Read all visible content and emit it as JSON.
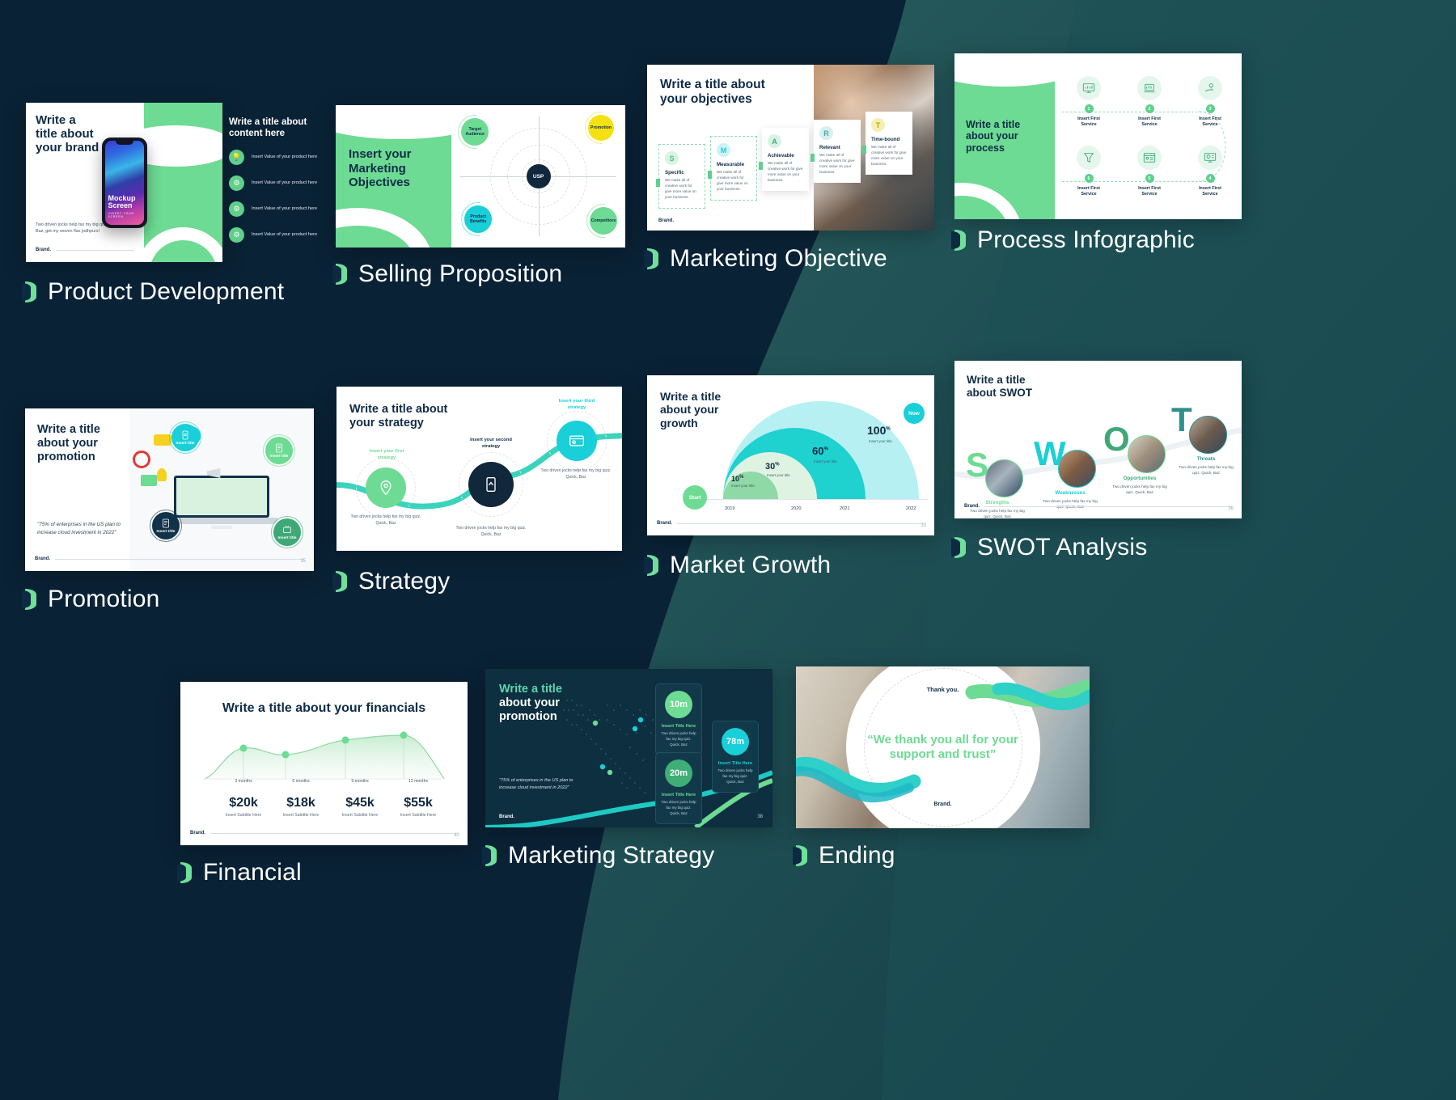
{
  "theme": {
    "bg_navy": "#0a2236",
    "bg_teal": "#1c4f50",
    "green": "#6ddb93",
    "cyan": "#19cfd8",
    "yellow": "#f5e111",
    "navy_text": "#0f2c47"
  },
  "slides": [
    {
      "id": "product",
      "caption": "Product Development",
      "title": "Write a title title about your brand",
      "title_lines": [
        "Write a",
        "title about",
        "your brand"
      ],
      "body": "Two driven jocks help fax my big quiz. Quick, Baz, get my woven flax jodhpurs!",
      "brand": "Brand.",
      "mockup_title_lines": [
        "Mockup",
        "Screen"
      ],
      "mockup_sub": "INSERT YOUR SCREEN",
      "side_title_lines": [
        "Write a title about",
        "content here"
      ],
      "side_items": [
        {
          "icon": "lightbulb-icon",
          "text": "Insert Value of your product here"
        },
        {
          "icon": "gear-icon",
          "text": "Insert Value of your product here"
        },
        {
          "icon": "gear-icon",
          "text": "Insert Value of your product here"
        },
        {
          "icon": "gear-icon",
          "text": "Insert Value of your product here"
        }
      ]
    },
    {
      "id": "selling",
      "caption": "Selling Proposition",
      "title_lines": [
        "Insert your",
        "Marketing",
        "Objectives"
      ],
      "center_label": "USP",
      "bubbles": [
        {
          "label": "Target Audience",
          "color": "#6ddb93"
        },
        {
          "label": "Promotion",
          "color": "#f5e111"
        },
        {
          "label": "Product Benefits",
          "color": "#19cfd8"
        },
        {
          "label": "Competitors",
          "color": "#6ddb93"
        }
      ]
    },
    {
      "id": "objective",
      "caption": "Marketing Objective",
      "title_lines": [
        "Write a title about",
        "your objectives"
      ],
      "brand": "Brand.",
      "cards": [
        {
          "letter": "S",
          "title": "Specific",
          "desc": "We make all of creative work for give more value on your business.",
          "badge_bg": "#d9f3e3",
          "badge_fg": "#4cc484"
        },
        {
          "letter": "M",
          "title": "Measurable",
          "desc": "We make all of creative work for give more value on your business.",
          "badge_bg": "#cdf3f6",
          "badge_fg": "#19cfd8"
        },
        {
          "letter": "A",
          "title": "Achievable",
          "desc": "We make all of creative work for give more value on your business.",
          "badge_bg": "#d9f3e3",
          "badge_fg": "#3fa877"
        },
        {
          "letter": "R",
          "title": "Relevant",
          "desc": "We make all of creative work for give more value on your business.",
          "badge_bg": "#d8eef0",
          "badge_fg": "#4aa9a8"
        },
        {
          "letter": "T",
          "title": "Time-bound",
          "desc": "We make all of creative work for give more value on your business.",
          "badge_bg": "#f6efb4",
          "badge_fg": "#b8a400"
        }
      ]
    },
    {
      "id": "process",
      "caption": "Process Infographic",
      "title_lines": [
        "Write a title",
        "about your",
        "process"
      ],
      "steps": [
        {
          "num": "1",
          "label_lines": [
            "Insert First",
            "Service"
          ],
          "icon": "monitor-chart-icon"
        },
        {
          "num": "2",
          "label_lines": [
            "Insert First",
            "Service"
          ],
          "icon": "laptop-chart-icon"
        },
        {
          "num": "3",
          "label_lines": [
            "Insert First",
            "Service"
          ],
          "icon": "hand-idea-icon"
        },
        {
          "num": "4",
          "label_lines": [
            "Insert First",
            "Service"
          ],
          "icon": "monitor-pie-icon"
        },
        {
          "num": "5",
          "label_lines": [
            "Insert First",
            "Service"
          ],
          "icon": "browser-user-icon"
        },
        {
          "num": "6",
          "label_lines": [
            "Insert First",
            "Service"
          ],
          "icon": "funnel-icon"
        }
      ]
    },
    {
      "id": "promotion",
      "caption": "Promotion",
      "title_lines": [
        "Write a title",
        "about your",
        "promotion"
      ],
      "quote": "\"75% of enterprises in the US plan to increase cloud investment in 2022\"",
      "brand": "Brand.",
      "page": "35",
      "bubbles": [
        {
          "label": "Insert title",
          "color": "#19cfd8",
          "icon": "mobile-settings-icon"
        },
        {
          "label": "Insert title",
          "color": "#6ddb93",
          "icon": "document-gear-icon"
        },
        {
          "label": "Insert title",
          "color": "#11324a",
          "icon": "document-user-icon"
        },
        {
          "label": "Insert title",
          "color": "#3fa877",
          "icon": "tv-icon"
        }
      ]
    },
    {
      "id": "strategy",
      "caption": "Strategy",
      "title_lines": [
        "Write a title about",
        "your strategy"
      ],
      "nodes": [
        {
          "label_lines": [
            "Insert your first",
            "strategy"
          ],
          "desc": "Two driven jocks help fax my big quiz. Quick, Baz",
          "color": "#6ddb93",
          "label_color": "#6ddb93",
          "icon": "location-pin-icon"
        },
        {
          "label_lines": [
            "Insert your second",
            "strategy"
          ],
          "desc": "Two driven jocks help fax my big quiz. Quick, Baz",
          "color": "#11273c",
          "label_color": "#0f2c47",
          "icon": "mobile-map-icon"
        },
        {
          "label_lines": [
            "Insert your third",
            "strategy"
          ],
          "desc": "Two driven jocks help fax my big quiz. Quick, Baz",
          "color": "#19cfd8",
          "label_color": "#19cfd8",
          "icon": "browser-ad-icon"
        }
      ]
    },
    {
      "id": "growth",
      "caption": "Market Growth",
      "title_lines": [
        "Write a title",
        "about your",
        "growth"
      ],
      "start_label": "Start",
      "now_label": "Now",
      "brand": "Brand.",
      "page": "33",
      "arcs": [
        {
          "value": "10",
          "unit": "%",
          "sub": "Insert your title",
          "year": "2019",
          "color": "#8ed9a5"
        },
        {
          "value": "30",
          "unit": "%",
          "sub": "Insert your title",
          "year": "2020",
          "color": "#dff3e3"
        },
        {
          "value": "60",
          "unit": "%",
          "sub": "Insert your title",
          "year": "2021",
          "color": "#1fd1cf"
        },
        {
          "value": "100",
          "unit": "%",
          "sub": "Insert your title",
          "year": "2022",
          "color": "#b6f0f2"
        }
      ]
    },
    {
      "id": "swot",
      "caption": "SWOT Analysis",
      "title_lines": [
        "Write a title",
        "about SWOT"
      ],
      "brand": "Brand.",
      "page": "36",
      "items": [
        {
          "letter": "S",
          "title": "Strengths",
          "desc": "Two driven jocks help fax my big quiz. Quick, Baz",
          "color": "#6ddb93"
        },
        {
          "letter": "W",
          "title": "Weaknesses",
          "desc": "Two driven jocks help fax my big quiz. Quick, Baz",
          "color": "#19cfd8"
        },
        {
          "letter": "O",
          "title": "Opportunities",
          "desc": "Two driven jocks help fax my big quiz. Quick, Baz",
          "color": "#3fa877"
        },
        {
          "letter": "T",
          "title": "Threats",
          "desc": "Two driven jocks help fax my big quiz. Quick, Baz",
          "color": "#2e8f8f"
        }
      ]
    },
    {
      "id": "financial",
      "caption": "Financial",
      "title": "Write a title about your financials",
      "brand": "Brand.",
      "page": "40",
      "columns": [
        {
          "period": "3 months",
          "amount": "$20k",
          "sub": "Insert Subtitle Here"
        },
        {
          "period": "6 months",
          "amount": "$18k",
          "sub": "Insert Subtitle Here"
        },
        {
          "period": "9 months",
          "amount": "$45k",
          "sub": "Insert Subtitle Here"
        },
        {
          "period": "12 months",
          "amount": "$55k",
          "sub": "Insert Subtitle Here"
        }
      ]
    },
    {
      "id": "mstrategy",
      "caption": "Marketing Strategy",
      "title_line1": "Write a title",
      "title_line2": "about your",
      "title_line3": "promotion",
      "quote": "\"75% of enterprises in the US plan to increase cloud investment in 2022\"",
      "brand": "Brand.",
      "page": "38",
      "cards": [
        {
          "value": "10m",
          "title": "Insert Title Here",
          "desc": "Two driven jocks help fax my big quiz. Quick, Baz",
          "color": "#6ddb93",
          "title_color": "#6ddb93"
        },
        {
          "value": "20m",
          "title": "Insert Title Here",
          "desc": "Two driven jocks help fax my big quiz. Quick, Baz",
          "color": "#3fae77",
          "title_color": "#6ddb93"
        },
        {
          "value": "78m",
          "title": "Insert Title Here",
          "desc": "Two driven jocks help fax my big quiz. Quick, Baz",
          "color": "#19cfd8",
          "title_color": "#19cfd8"
        }
      ]
    },
    {
      "id": "ending",
      "caption": "Ending",
      "thank_you": "Thank you.",
      "quote": "“We thank you all for your support and trust”",
      "brand": "Brand."
    }
  ],
  "chart_data": [
    {
      "type": "bar",
      "title": "Write a title about your growth",
      "categories": [
        "2019",
        "2020",
        "2021",
        "2022"
      ],
      "values": [
        10,
        30,
        60,
        100
      ],
      "ylabel": "%",
      "xlabel": "",
      "ylim": [
        0,
        100
      ],
      "annotations": [
        "Start",
        "Now"
      ],
      "point_labels": [
        "Insert your title",
        "Insert your title",
        "Insert your title",
        "Insert your title"
      ]
    },
    {
      "type": "area",
      "title": "Write a title about your financials",
      "categories": [
        "3 months",
        "6 months",
        "9 months",
        "12 months"
      ],
      "values": [
        20,
        18,
        45,
        55
      ],
      "ylabel": "$k",
      "xlabel": "",
      "ylim": [
        0,
        60
      ],
      "data_labels": [
        "$20k",
        "$18k",
        "$45k",
        "$55k"
      ]
    }
  ]
}
